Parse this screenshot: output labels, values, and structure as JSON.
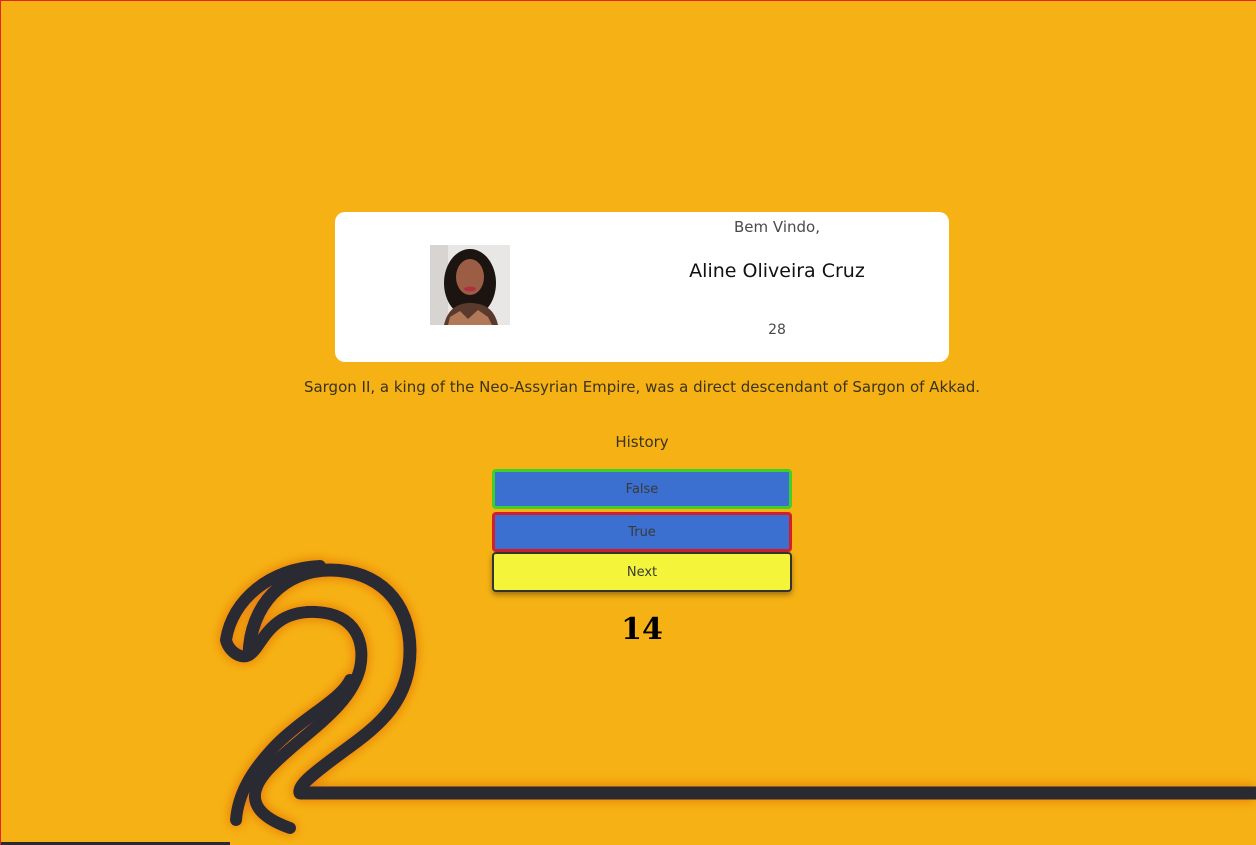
{
  "profile": {
    "greeting": "Bem Vindo,",
    "name": "Aline Oliveira Cruz",
    "age": "28"
  },
  "quiz": {
    "question": "Sargon II, a king of the Neo-Assyrian Empire, was a direct descendant of Sargon of Akkad.",
    "category": "History",
    "answers": [
      {
        "label": "False",
        "state": "correct"
      },
      {
        "label": "True",
        "state": "wrong"
      }
    ],
    "next_label": "Next",
    "counter": "14"
  },
  "colors": {
    "background": "#f6b214",
    "card": "#ffffff",
    "answer_button": "#3b6fd0",
    "correct_border": "#3fcf2b",
    "wrong_border": "#d41f2a",
    "next_button": "#f4f43a",
    "decoration": "#2b2a33"
  },
  "icons": {
    "decoration": "question-mark-icon"
  }
}
